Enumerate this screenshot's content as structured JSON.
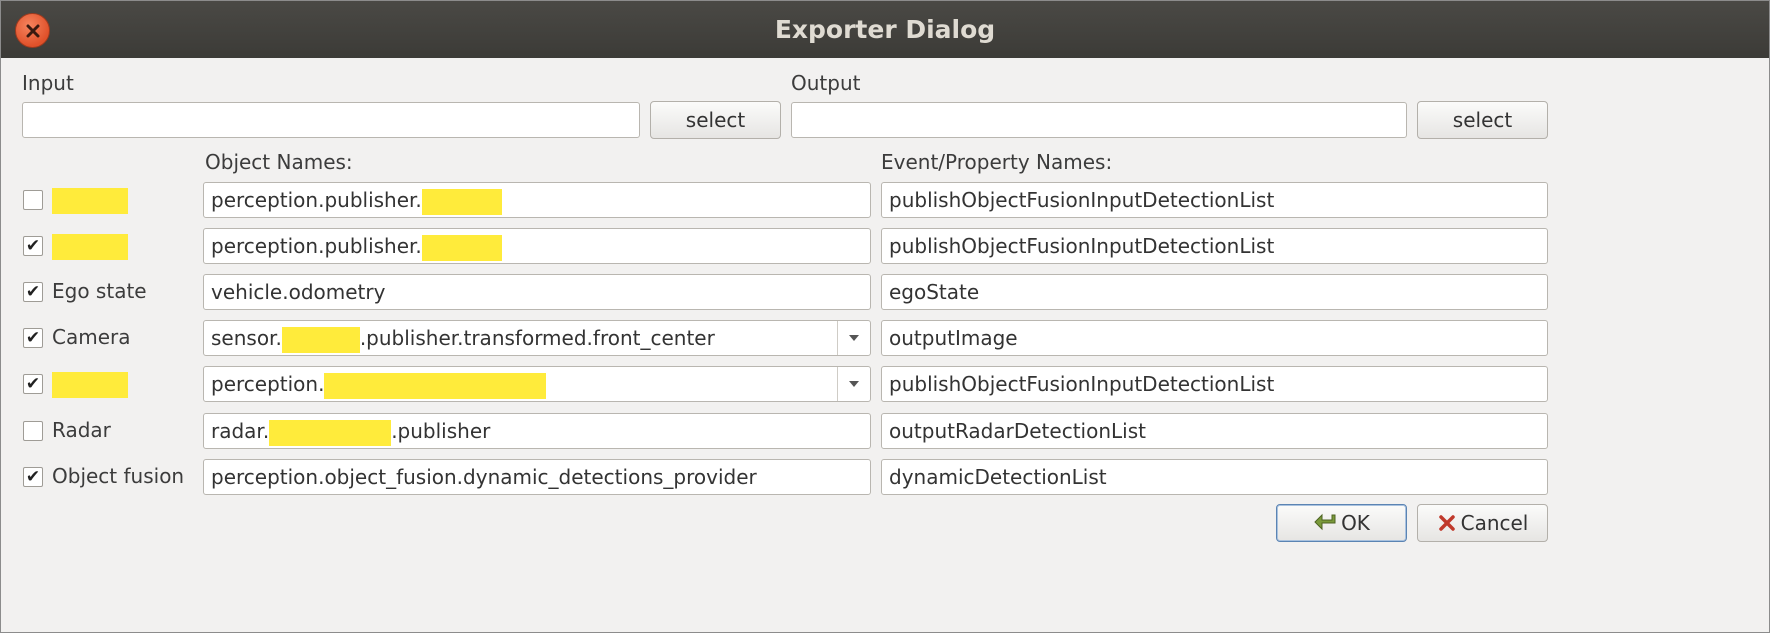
{
  "window": {
    "title": "Exporter Dialog"
  },
  "input": {
    "label": "Input",
    "value": "",
    "select_label": "select"
  },
  "output": {
    "label": "Output",
    "value": "",
    "select_label": "select"
  },
  "headers": {
    "object_names": "Object Names:",
    "event_names": "Event/Property Names:"
  },
  "rows": [
    {
      "checked": false,
      "label": "",
      "object_parts": [
        "perception.publisher.",
        ""
      ],
      "event": "publishObjectFusionInputDetectionList",
      "combo": false
    },
    {
      "checked": true,
      "label": "",
      "object_parts": [
        "perception.publisher.",
        ""
      ],
      "event": "publishObjectFusionInputDetectionList",
      "combo": false
    },
    {
      "checked": true,
      "label": "Ego state",
      "object_parts": [
        "vehicle.odometry"
      ],
      "event": "egoState",
      "combo": false
    },
    {
      "checked": true,
      "label": "Camera",
      "object_parts": [
        "sensor.",
        "",
        ".publisher.transformed.front_center"
      ],
      "event": "outputImage",
      "combo": true
    },
    {
      "checked": true,
      "label": "",
      "object_parts": [
        "perception.",
        ""
      ],
      "event": "publishObjectFusionInputDetectionList",
      "combo": true
    },
    {
      "checked": false,
      "label": "Radar",
      "object_parts": [
        "radar.",
        "",
        ".publisher"
      ],
      "event": "outputRadarDetectionList",
      "combo": false
    },
    {
      "checked": true,
      "label": "Object fusion",
      "object_parts": [
        "perception.object_fusion.dynamic_detections_provider"
      ],
      "event": "dynamicDetectionList",
      "combo": false
    }
  ],
  "buttons": {
    "ok_label": "OK",
    "cancel_label": "Cancel"
  },
  "checkmark": "✔",
  "icons": {
    "close": "close-icon",
    "ok": "ok-arrow-icon",
    "cancel": "cancel-x-icon",
    "dropdown": "chevron-down-icon"
  },
  "colors": {
    "redaction": "#ffeb3b",
    "close": "#e0512a",
    "titlebar": "#3c3b37"
  }
}
